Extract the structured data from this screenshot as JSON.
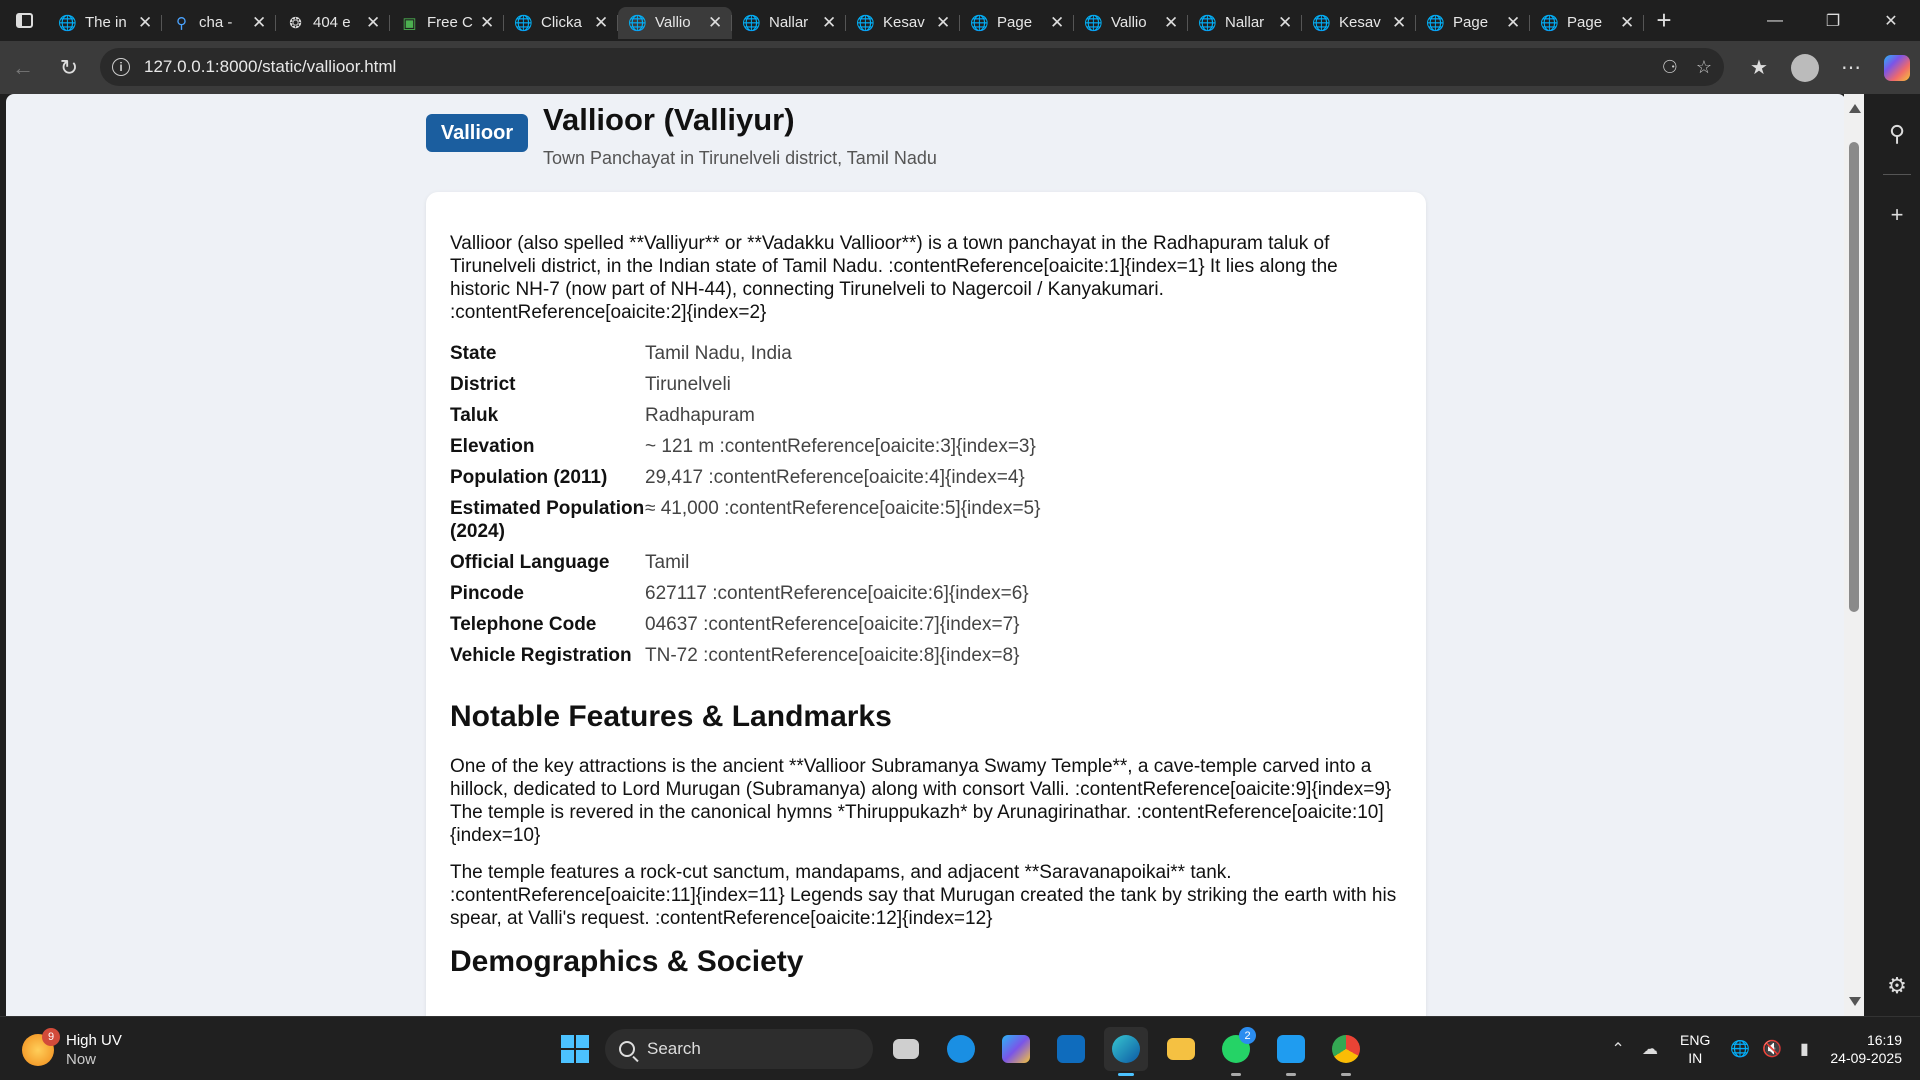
{
  "browser": {
    "tabs": [
      {
        "label": "The in",
        "icon": "globe-icon"
      },
      {
        "label": "cha -",
        "icon": "search-icon"
      },
      {
        "label": "404 e",
        "icon": "chatgpt-icon"
      },
      {
        "label": "Free C",
        "icon": "image-icon"
      },
      {
        "label": "Clicka",
        "icon": "globe-icon"
      },
      {
        "label": "Vallio",
        "icon": "globe-icon",
        "active": true
      },
      {
        "label": "Nallar",
        "icon": "globe-icon"
      },
      {
        "label": "Kesav",
        "icon": "globe-icon"
      },
      {
        "label": "Page",
        "icon": "globe-icon"
      },
      {
        "label": "Vallio",
        "icon": "globe-icon"
      },
      {
        "label": "Nallar",
        "icon": "globe-icon"
      },
      {
        "label": "Kesav",
        "icon": "globe-icon"
      },
      {
        "label": "Page",
        "icon": "globe-icon"
      },
      {
        "label": "Page",
        "icon": "globe-icon"
      }
    ],
    "url": "127.0.0.1:8000/static/vallioor.html"
  },
  "page": {
    "badge": "Vallioor",
    "title": "Vallioor (Valliyur)",
    "subtitle": "Town Panchayat in Tirunelveli district, Tamil Nadu",
    "intro": "Vallioor (also spelled **Valliyur** or **Vadakku Vallioor**) is a town panchayat in the Radhapuram taluk of Tirunelveli district, in the Indian state of Tamil Nadu. :contentReference[oaicite:1]{index=1} It lies along the historic NH-7 (now part of NH-44), connecting Tirunelveli to Nagercoil / Kanyakumari. :contentReference[oaicite:2]{index=2}",
    "facts": [
      {
        "key": "State",
        "value": "Tamil Nadu, India"
      },
      {
        "key": "District",
        "value": "Tirunelveli"
      },
      {
        "key": "Taluk",
        "value": "Radhapuram"
      },
      {
        "key": "Elevation",
        "value": "~ 121 m :contentReference[oaicite:3]{index=3}"
      },
      {
        "key": "Population (2011)",
        "value": "29,417 :contentReference[oaicite:4]{index=4}"
      },
      {
        "key": "Estimated Population (2024)",
        "value": "≈ 41,000 :contentReference[oaicite:5]{index=5}"
      },
      {
        "key": "Official Language",
        "value": "Tamil"
      },
      {
        "key": "Pincode",
        "value": "627117 :contentReference[oaicite:6]{index=6}"
      },
      {
        "key": "Telephone Code",
        "value": "04637 :contentReference[oaicite:7]{index=7}"
      },
      {
        "key": "Vehicle Registration",
        "value": "TN-72 :contentReference[oaicite:8]{index=8}"
      }
    ],
    "section_heading": "Notable Features & Landmarks",
    "section_paragraphs": [
      "One of the key attractions is the ancient **Vallioor Subramanya Swamy Temple**, a cave-temple carved into a hillock, dedicated to Lord Murugan (Subramanya) along with consort Valli. :contentReference[oaicite:9]{index=9} The temple is revered in the canonical hymns *Thiruppukazh* by Arunagirinathar. :contentReference[oaicite:10]{index=10}",
      "The temple features a rock-cut sanctum, mandapams, and adjacent **Saravanapoikai** tank. :contentReference[oaicite:11]{index=11} Legends say that Murugan created the tank by striking the earth with his spear, at Valli's request. :contentReference[oaicite:12]{index=12}"
    ],
    "next_heading": "Demographics & Society"
  },
  "taskbar": {
    "weather_badge": "9",
    "weather_title": "High UV",
    "weather_sub": "Now",
    "search_label": "Search",
    "whatsapp_count": "2",
    "lang_top": "ENG",
    "lang_bottom": "IN",
    "time": "16:19",
    "date": "24-09-2025"
  },
  "colors": {
    "badge": "#1b5e9f",
    "page_bg": "#eef1f6",
    "accent": "#4cc2ff"
  }
}
